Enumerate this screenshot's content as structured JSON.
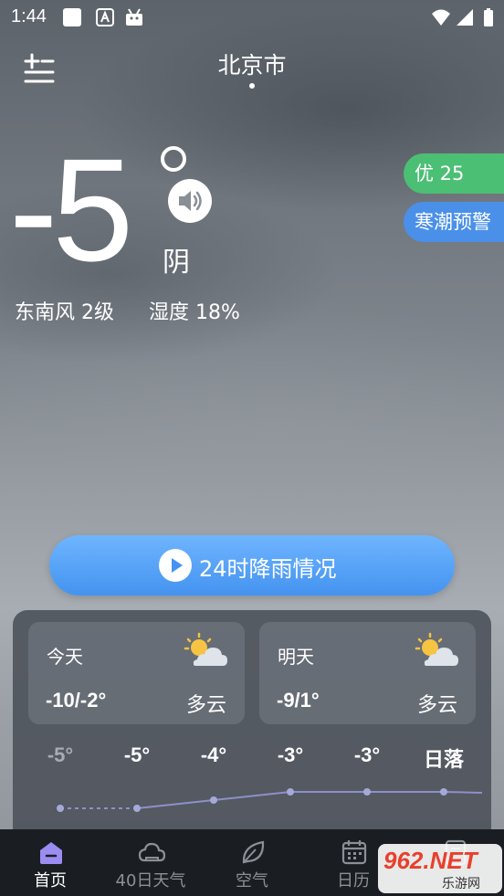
{
  "status_bar": {
    "time": "1:44"
  },
  "header": {
    "city": "北京市"
  },
  "current": {
    "temperature": "-5",
    "condition": "阴",
    "wind": "东南风 2级",
    "humidity": "湿度 18%"
  },
  "badges": {
    "aqi": "优 25",
    "warning": "寒潮预警"
  },
  "rain_button": {
    "label": "24时降雨情况"
  },
  "forecast": {
    "today": {
      "name": "今天",
      "range": "-10/-2°",
      "condition": "多云"
    },
    "tomorrow": {
      "name": "明天",
      "range": "-9/1°",
      "condition": "多云"
    }
  },
  "hourly": {
    "labels": [
      "-5°",
      "-5°",
      "-4°",
      "-3°",
      "-3°",
      "日落"
    ],
    "temps": [
      -5,
      -5,
      -4,
      -3,
      -3,
      -3
    ],
    "past_count": 1
  },
  "nav": {
    "items": [
      {
        "label": "首页",
        "icon": "home-icon"
      },
      {
        "label": "40日天气",
        "icon": "cloud-icon"
      },
      {
        "label": "空气",
        "icon": "leaf-icon"
      },
      {
        "label": "日历",
        "icon": "calendar-icon"
      },
      {
        "label": "",
        "icon": "document-icon"
      }
    ]
  },
  "watermark": {
    "brand": "962.NET",
    "sub": "乐游网"
  },
  "colors": {
    "aqi_good": "#4bbf74",
    "warning": "#4a90e8",
    "accent": "#4493f0"
  }
}
